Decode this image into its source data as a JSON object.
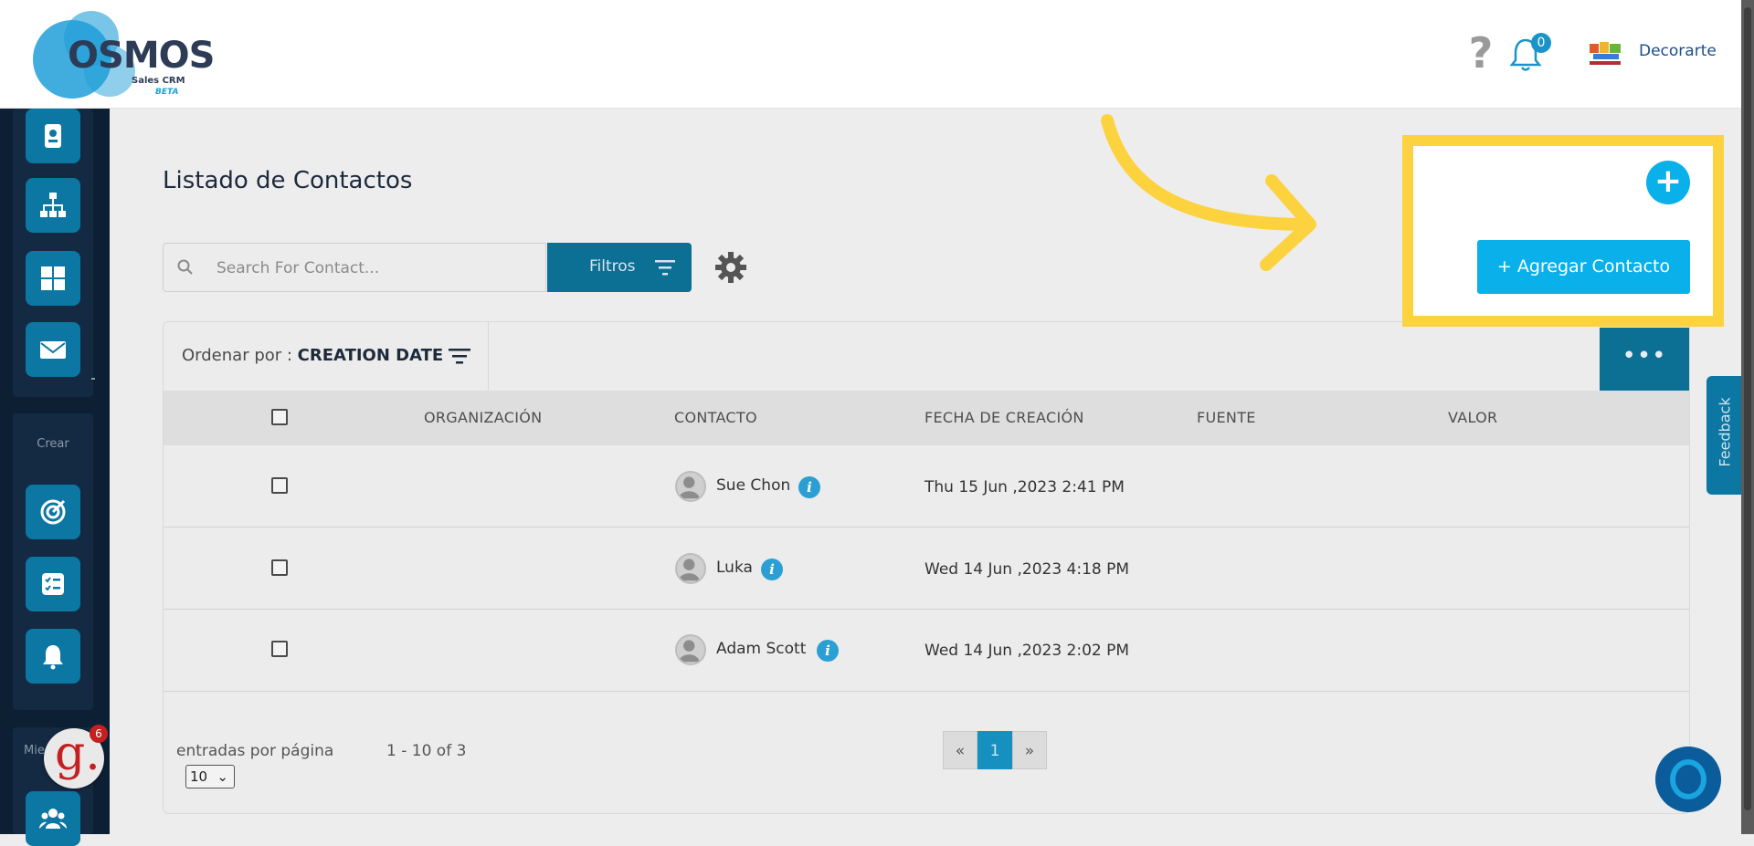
{
  "app": {
    "logo_text": "OSMOS",
    "logo_sub": "Sales CRM",
    "logo_badge": "BETA"
  },
  "header": {
    "notification_count": "0",
    "company_name": "Decorarte"
  },
  "sidebar": {
    "sections": [
      {
        "label": ""
      },
      {
        "label": "Crear"
      },
      {
        "label": "Mie"
      }
    ],
    "top_icons": [
      "contact-card-icon",
      "org-chart-icon",
      "dashboard-grid-icon",
      "mail-icon"
    ],
    "create_icons": [
      "target-icon",
      "checklist-icon",
      "bell-icon"
    ],
    "bottom_icons": [
      "team-icon"
    ]
  },
  "page": {
    "title": "Listado de Contactos",
    "search_placeholder": "Search For Contact...",
    "filter_label": "Filtros"
  },
  "sort": {
    "label": "Ordenar por :",
    "value": "CREATION DATE"
  },
  "more_label": "•••",
  "table": {
    "columns": [
      "ORGANIZACIÓN",
      "CONTACTO",
      "FECHA DE CREACIÓN",
      "FUENTE",
      "VALOR"
    ],
    "rows": [
      {
        "organization": "",
        "contact": "Sue Chon",
        "created": "Thu 15 Jun ,2023 2:41 PM",
        "source": "",
        "value": ""
      },
      {
        "organization": "",
        "contact": "Luka",
        "created": "Wed 14 Jun ,2023 4:18 PM",
        "source": "",
        "value": ""
      },
      {
        "organization": "",
        "contact": "Adam Scott",
        "created": "Wed 14 Jun ,2023 2:02 PM",
        "source": "",
        "value": ""
      }
    ]
  },
  "pagination": {
    "per_page_label": "entradas por página",
    "per_page_value": "10",
    "range_text": "1 - 10 of 3",
    "prev": "«",
    "current": "1",
    "next": "»"
  },
  "callout": {
    "plus_label": "+",
    "add_contact_label": "+ Agregar Contacto",
    "highlight_color": "#fdd23f"
  },
  "feedback_label": "Feedback",
  "grammarly_count": "6",
  "colors": {
    "accent": "#0ab0ea",
    "sidebar": "#0d1f33",
    "highlight": "#fdd23f"
  }
}
